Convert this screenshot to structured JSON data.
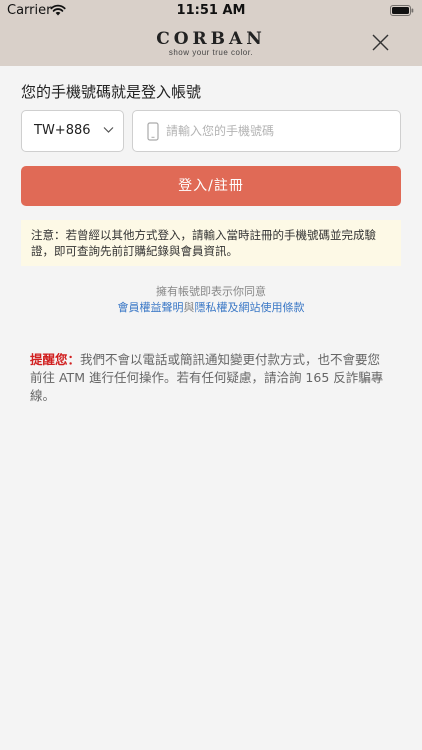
{
  "status_bar": {
    "carrier": "Carrier",
    "time": "11:51 AM"
  },
  "header": {
    "logo_text": "CORBAN",
    "logo_tagline": "show your true color."
  },
  "form": {
    "title": "您的手機號碼就是登入帳號",
    "country_code": "TW+886",
    "phone_placeholder": "請輸入您的手機號碼",
    "phone_value": "",
    "submit_label": "登入/註冊"
  },
  "notice": {
    "text": "注意：若曾經以其他方式登入，請輸入當時註冊的手機號碼並完成驗證，即可查詢先前訂購紀錄與會員資訊。"
  },
  "agreement": {
    "text": "擁有帳號即表示你同意",
    "member_terms": "會員權益聲明",
    "conjunction": "與",
    "privacy_terms": "隱私權及網站使用條款"
  },
  "reminder": {
    "label": "提醒您：",
    "text": "我們不會以電話或簡訊通知變更付款方式，也不會要您前往 ATM 進行任何操作。若有任何疑慮，請洽詢 165 反詐騙專線。"
  },
  "colors": {
    "header_bg": "#d9d0c9",
    "primary_button": "#e06a56",
    "notice_bg": "#fdf9e6",
    "link": "#3b78c6",
    "reminder_label": "#d11f1f"
  },
  "icons": {
    "wifi": "wifi-icon",
    "battery": "battery-icon",
    "close": "close-icon",
    "dropdown": "chevron-down-icon",
    "phone": "mobile-phone-icon"
  }
}
